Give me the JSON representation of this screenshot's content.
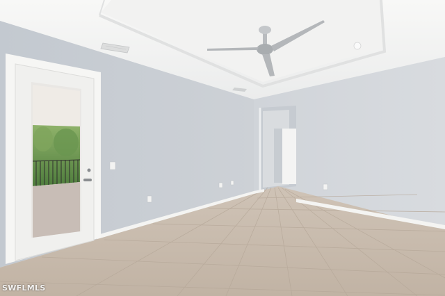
{
  "scene": {
    "description_free": true,
    "colors": {
      "wall_left": "#c8cdd3",
      "wall_right": "#d3d7dc",
      "ceiling": "#f3f3f2",
      "floor": "#c9bcae",
      "baseboard": "#f4f4f2",
      "door_frame": "#f6f6f4",
      "fan_metal": "#b9bcbf"
    },
    "icons": [
      "ceiling-fan-icon",
      "air-vent-icon",
      "light-switch-icon",
      "outlet-icon"
    ]
  },
  "watermark": {
    "text": "SWFLMLS"
  }
}
